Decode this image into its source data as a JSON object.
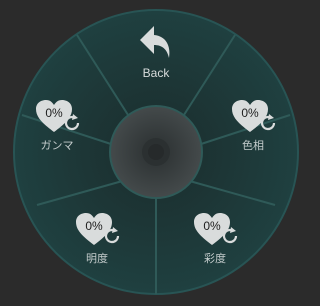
{
  "back": {
    "label": "Back",
    "icon": "back-arrow-icon"
  },
  "slots": {
    "gamma": {
      "label": "ガンマ",
      "value": "0%"
    },
    "hue": {
      "label": "色相",
      "value": "0%"
    },
    "brightness": {
      "label": "明度",
      "value": "0%"
    },
    "saturation": {
      "label": "彩度",
      "value": "0%"
    }
  },
  "colors": {
    "background": "#2b2b2b",
    "ring": "#1f3e3e",
    "divider": "#2f5a58",
    "center": "#3a3f40",
    "heart": "#d9dcdc"
  }
}
